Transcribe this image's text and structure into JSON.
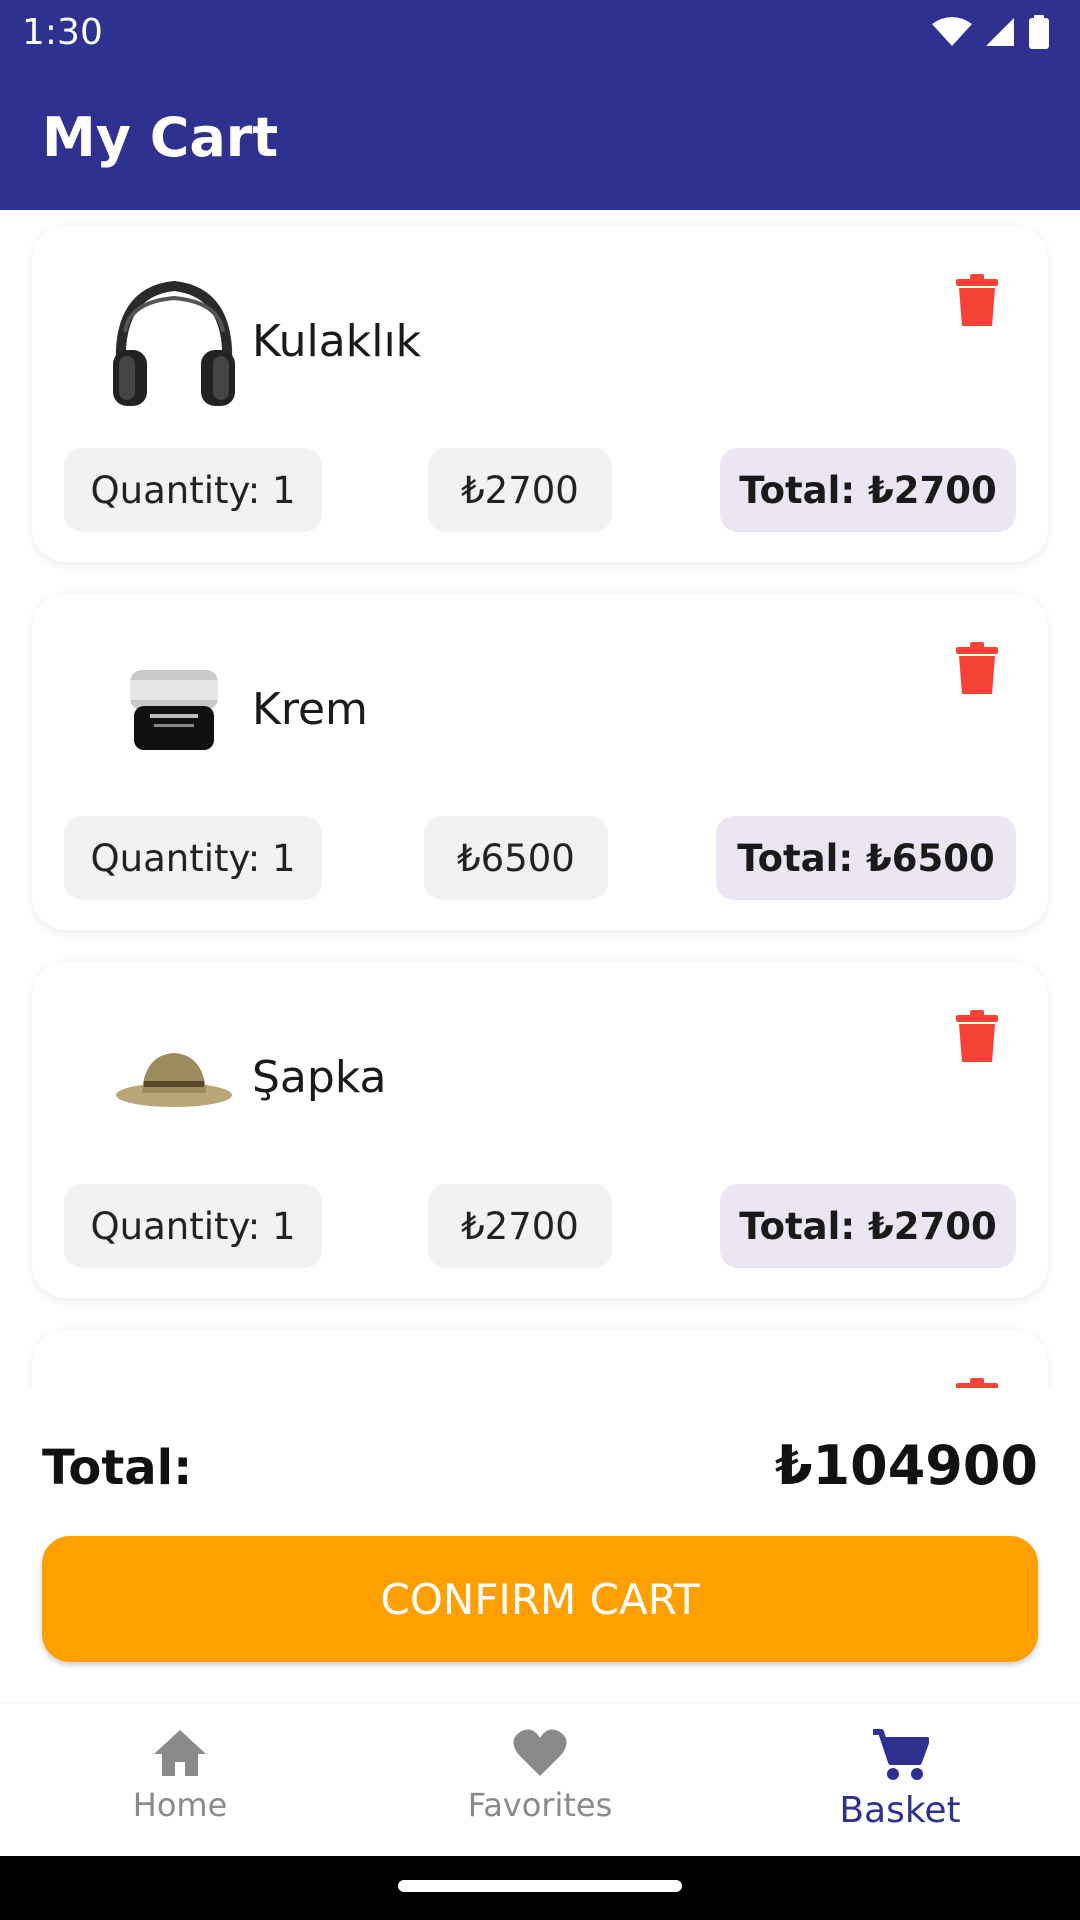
{
  "status_bar": {
    "time": "1:30"
  },
  "app_bar": {
    "title": "My Cart"
  },
  "cart_items": [
    {
      "name": "Kulaklık",
      "quantity": "Quantity: 1",
      "price": "₺2700",
      "total": "Total: ₺2700",
      "icon": "headphones-image"
    },
    {
      "name": "Krem",
      "quantity": "Quantity: 1",
      "price": "₺6500",
      "total": "Total: ₺6500",
      "icon": "cream-jar-image"
    },
    {
      "name": "Şapka",
      "quantity": "Quantity: 1",
      "price": "₺2700",
      "total": "Total: ₺2700",
      "icon": "straw-hat-image"
    }
  ],
  "summary": {
    "label": "Total:",
    "value": "₺104900",
    "confirm_label": "CONFIRM CART"
  },
  "bottom_nav": [
    {
      "label": "Home",
      "icon": "home-icon",
      "active": false
    },
    {
      "label": "Favorites",
      "icon": "heart-icon",
      "active": false
    },
    {
      "label": "Basket",
      "icon": "cart-icon",
      "active": true
    }
  ],
  "colors": {
    "primary": "#2e3190",
    "accent": "#ffa000",
    "delete": "#f44336",
    "total_chip": "#ece6f4",
    "chip": "#f2f2f2"
  }
}
